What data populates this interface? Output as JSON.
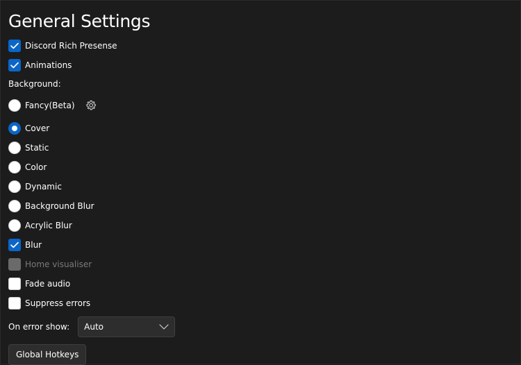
{
  "page": {
    "title": "General Settings"
  },
  "checks_top": [
    {
      "label": "Discord Rich Presense",
      "checked": true
    },
    {
      "label": "Animations",
      "checked": true
    }
  ],
  "background": {
    "label": "Background:",
    "options": [
      {
        "label": "Fancy(Beta)",
        "selected": false,
        "has_settings": true
      },
      {
        "label": "Cover",
        "selected": true
      },
      {
        "label": "Static",
        "selected": false
      },
      {
        "label": "Color",
        "selected": false
      },
      {
        "label": "Dynamic",
        "selected": false
      },
      {
        "label": "Background Blur",
        "selected": false
      },
      {
        "label": "Acrylic Blur",
        "selected": false
      }
    ]
  },
  "checks_bottom": [
    {
      "label": "Blur",
      "checked": true,
      "disabled": false
    },
    {
      "label": "Home visualiser",
      "checked": false,
      "disabled": true
    },
    {
      "label": "Fade audio",
      "checked": false,
      "disabled": false
    },
    {
      "label": "Suppress errors",
      "checked": false,
      "disabled": false
    }
  ],
  "error_show": {
    "label": "On error show:",
    "value": "Auto"
  },
  "buttons": {
    "global_hotkeys": "Global Hotkeys"
  },
  "icons": {
    "fancy_settings": "gear-icon",
    "dropdown": "chevron-down-icon",
    "check": "checkmark-icon"
  },
  "colors": {
    "background": "#1c1c1c",
    "accent": "#0a66c9",
    "text": "#ffffff",
    "disabled": "#6a6a6a"
  }
}
